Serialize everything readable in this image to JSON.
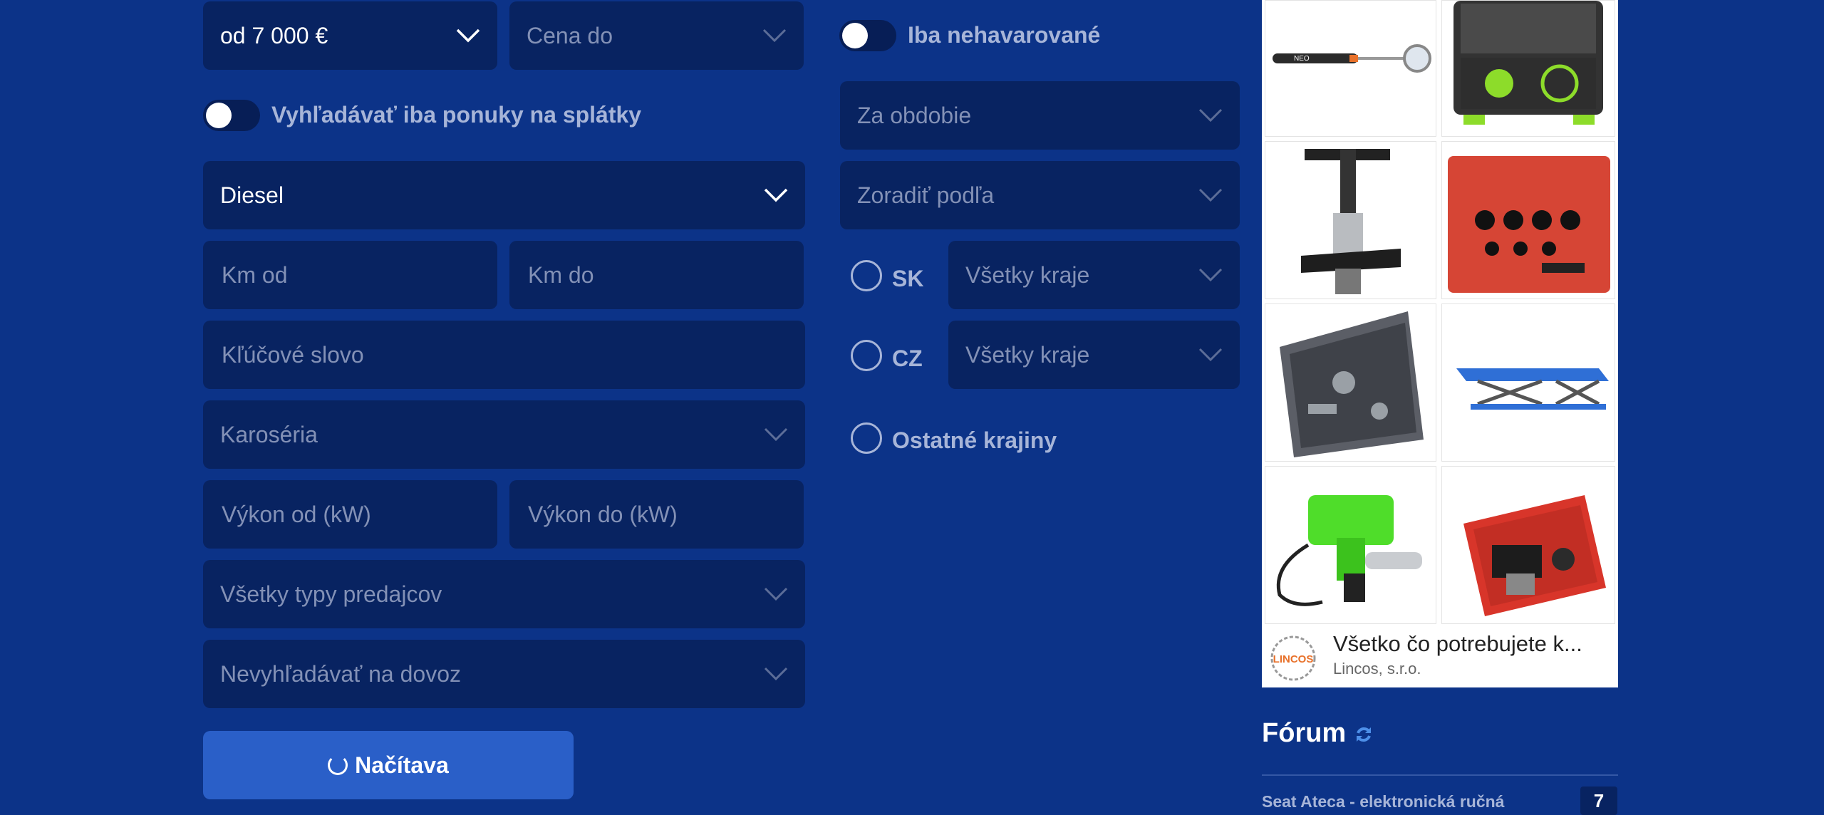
{
  "filters": {
    "price_from": "od 7 000 €",
    "price_to_placeholder": "Cena do",
    "installments_label": "Vyhľadávať iba ponuky na splátky",
    "fuel": "Diesel",
    "km_from_placeholder": "Km od",
    "km_to_placeholder": "Km do",
    "keyword_placeholder": "Kľúčové slovo",
    "body_placeholder": "Karoséria",
    "power_from_placeholder": "Výkon od (kW)",
    "power_to_placeholder": "Výkon do (kW)",
    "seller_type": "Všetky typy predajcov",
    "import": "Nevyhľadávať na dovoz",
    "submit_label": "Načítava"
  },
  "right_filters": {
    "undamaged_label": "Iba nehavarované",
    "period": "Za obdobie",
    "sort": "Zoradiť podľa",
    "sk_label": "SK",
    "sk_regions": "Všetky kraje",
    "cz_label": "CZ",
    "cz_regions": "Všetky kraje",
    "other_label": "Ostatné krajiny"
  },
  "ad": {
    "title": "Všetko čo potrebujete k...",
    "advertiser": "Lincos, s.r.o.",
    "logo_text": "LINCOS",
    "products": [
      "neo-inspection-mirror",
      "tool-case-green",
      "brake-piston-tool",
      "red-socket-case",
      "grey-tool-case",
      "blue-car-lift",
      "green-grease-gun",
      "red-press-case"
    ]
  },
  "forum": {
    "title": "Fórum",
    "first_item": "Seat Ateca - elektronická ručná",
    "first_item_count": "7"
  },
  "colors": {
    "background": "#0c3388",
    "field": "#082361",
    "button": "#2a5fc8"
  }
}
